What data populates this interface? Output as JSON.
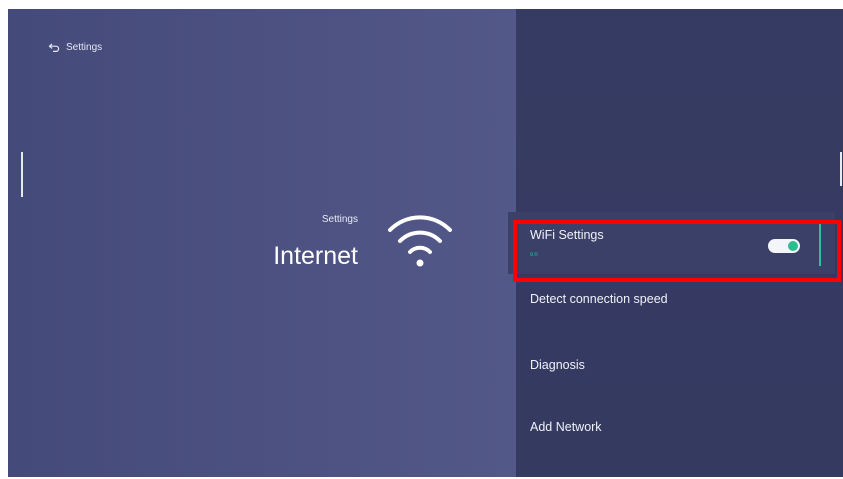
{
  "header": {
    "back_label": "Settings"
  },
  "heading": {
    "subtitle": "Settings",
    "title": "Internet"
  },
  "menu": {
    "items": [
      {
        "label": "WiFi Settings",
        "status": "on",
        "toggle_on": true
      },
      {
        "label": "Detect connection speed"
      },
      {
        "label": "Diagnosis"
      },
      {
        "label": "Add Network"
      }
    ]
  },
  "colors": {
    "accent": "#2fbf9f",
    "highlight_box": "#ff0000",
    "left_pane": "#4b5080",
    "right_pane": "#363b63"
  },
  "icons": {
    "back": "back-arrow-icon",
    "wifi": "wifi-icon"
  }
}
